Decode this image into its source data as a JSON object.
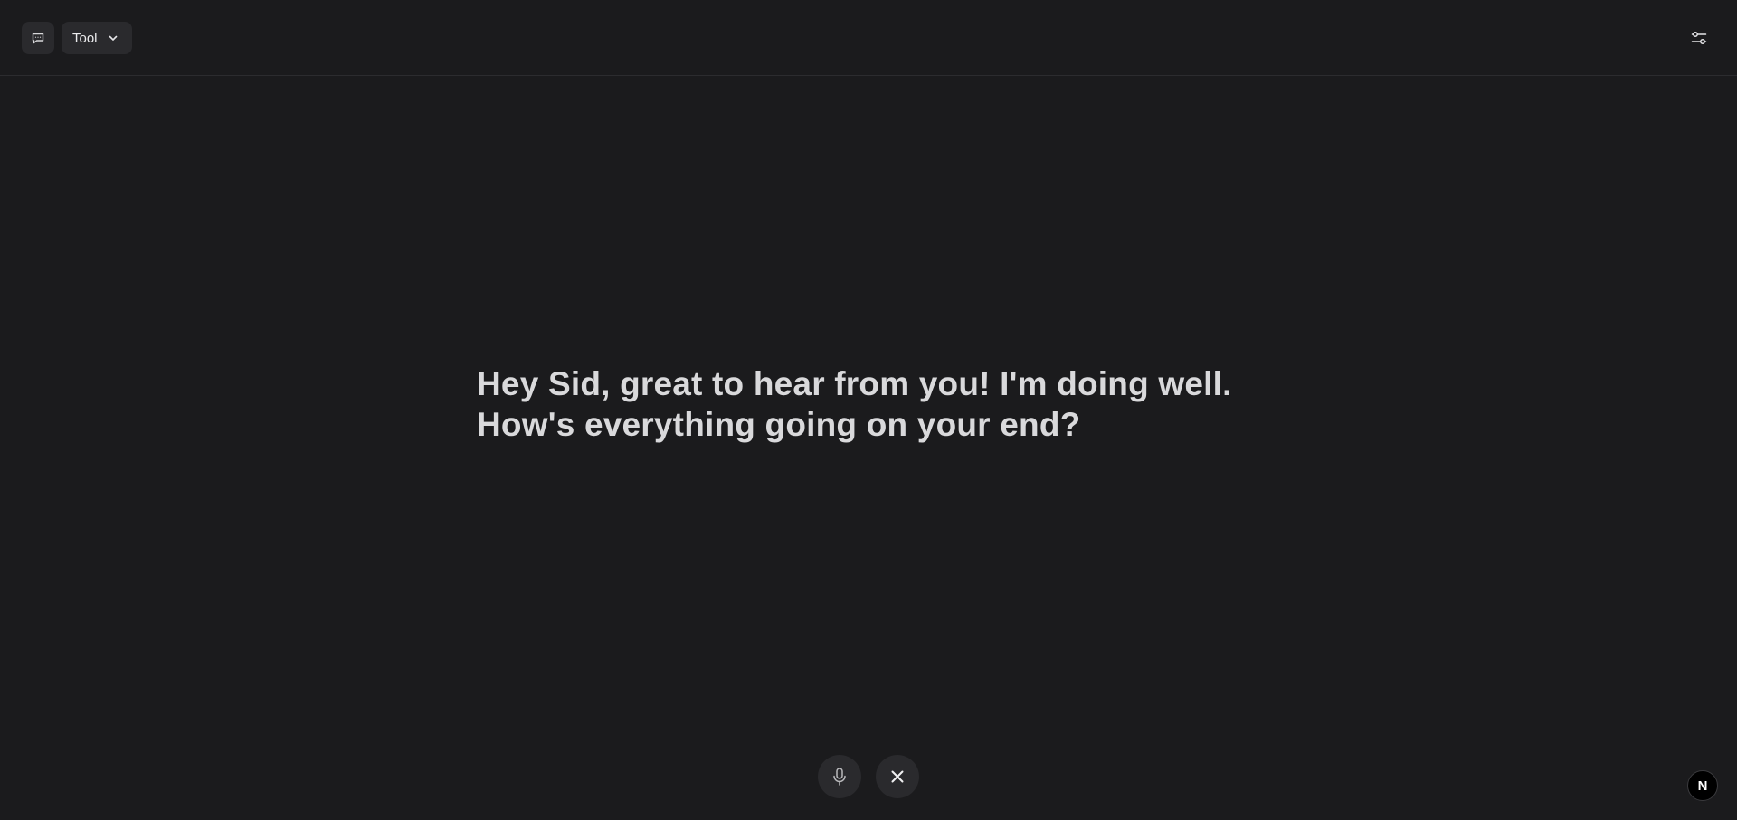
{
  "header": {
    "tool_dropdown_label": "Tool",
    "icons": {
      "chat_toggle": "chat-bubble-icon",
      "dropdown": "chevron-down-icon",
      "settings": "sliders-icon"
    }
  },
  "conversation": {
    "message_lines": [
      "Hey Sid, great to hear from you! I'm doing well.",
      "How's everything going on your end?"
    ]
  },
  "controls": {
    "mic_icon": "microphone-icon",
    "close_icon": "close-icon"
  },
  "badge": {
    "letter": "N"
  },
  "colors": {
    "background": "#1b1b1d",
    "button_bg": "#2a2a2d",
    "text": "#d9d9db"
  }
}
